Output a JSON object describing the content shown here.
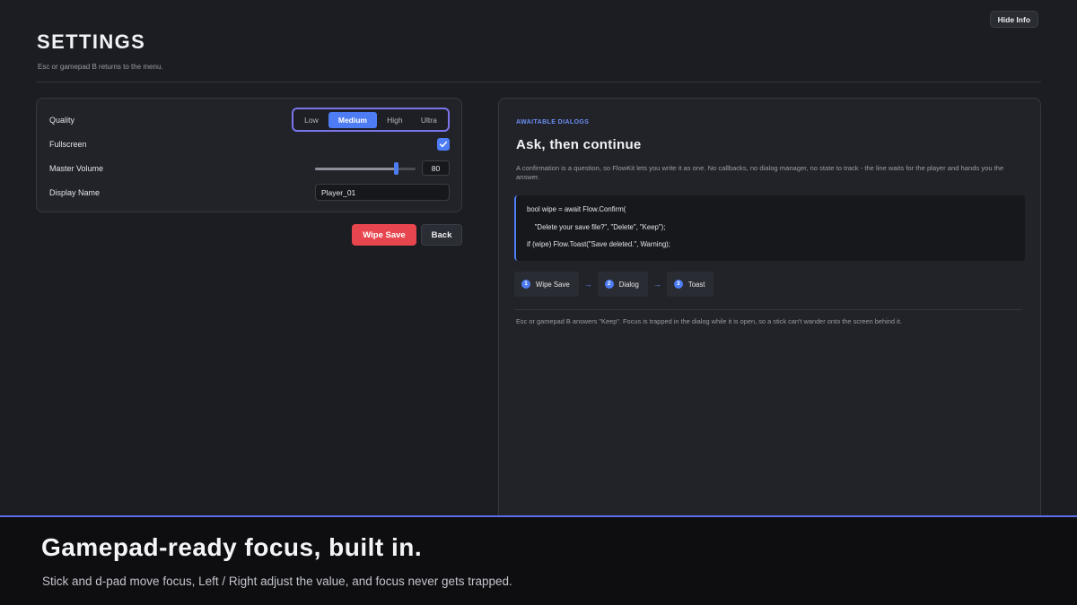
{
  "hide_info_label": "Hide Info",
  "header": {
    "title": "SETTINGS",
    "subtitle": "Esc or gamepad B returns to the menu."
  },
  "settings": {
    "quality": {
      "label": "Quality",
      "options": [
        "Low",
        "Medium",
        "High",
        "Ultra"
      ],
      "selected": "Medium"
    },
    "fullscreen": {
      "label": "Fullscreen",
      "checked": true
    },
    "master_volume": {
      "label": "Master Volume",
      "value": "80",
      "fraction": 0.8
    },
    "display_name": {
      "label": "Display Name",
      "value": "Player_01"
    }
  },
  "actions": {
    "wipe_save": "Wipe Save",
    "back": "Back"
  },
  "info": {
    "eyebrow": "AWAITABLE DIALOGS",
    "title": "Ask, then continue",
    "description": "A confirmation is a question, so FlowKit lets you write it as one. No callbacks, no dialog manager, no state to track - the line waits for the player and hands you the answer.",
    "code_lines": [
      "bool wipe = await Flow.Confirm(",
      "    \"Delete your save file?\", \"Delete\", \"Keep\");",
      "if (wipe) Flow.Toast(\"Save deleted.\", Warning);"
    ],
    "steps": [
      {
        "num": "1",
        "label": "Wipe Save"
      },
      {
        "num": "2",
        "label": "Dialog"
      },
      {
        "num": "3",
        "label": "Toast"
      }
    ],
    "arrow": "→",
    "footnote": "Esc or gamepad B answers \"Keep\". Focus is trapped in the dialog while it is open, so a stick can't wander onto the screen behind it."
  },
  "banner": {
    "title": "Gamepad-ready focus, built in.",
    "subtitle": "Stick and d-pad move focus, Left / Right adjust the value, and focus never gets trapped."
  },
  "colors": {
    "accent": "#4d7cf5",
    "focus_ring": "#7a75ea",
    "danger": "#e8464e",
    "background": "#1c1d22"
  }
}
